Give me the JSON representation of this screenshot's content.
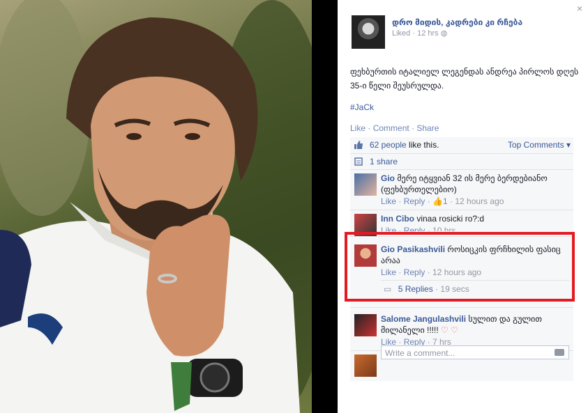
{
  "post": {
    "page_name": "დრო მიდის, კადრები კი რჩება",
    "meta_liked": "Liked",
    "meta_time": "12 hrs",
    "text": "ფეხბურთის იტალიელ ლეგენდას ანდრეა პირლოს დღეს 35-ი წელი შეუსრულდა.",
    "hashtag": "#JaCk",
    "actions": [
      "Like",
      "Comment",
      "Share"
    ],
    "close": "×"
  },
  "ufi": {
    "likes_count": "62 people",
    "likes_suffix": " like this.",
    "top_comments": "Top Comments ▾",
    "shares": "1 share"
  },
  "comments": [
    {
      "name": "Gio",
      "text": "მერე იტყვიან 32 ის მერე ბერდებიანო (ფეხბურთელებიო)",
      "like": "Like",
      "reply": "Reply",
      "likes": "1",
      "time": "12 hours ago"
    },
    {
      "name": "Inn Cibo",
      "text": "vinaa rosicki ro?:d",
      "like": "Like",
      "reply": "Reply",
      "time": "10 hrs"
    },
    {
      "name": "Gio Pasikashvili",
      "text": "როსიცკის ფრჩხილის ფასიც არაა",
      "like": "Like",
      "reply": "Reply",
      "time": "12 hours ago",
      "replies": "5 Replies",
      "replies_time": "19 secs"
    },
    {
      "name": "Salome Jangulashvili",
      "text": "სულით და გულით მილანელი !!!!!",
      "like": "Like",
      "reply": "Reply",
      "time": "7 hrs"
    }
  ],
  "write_placeholder": "Write a comment..."
}
